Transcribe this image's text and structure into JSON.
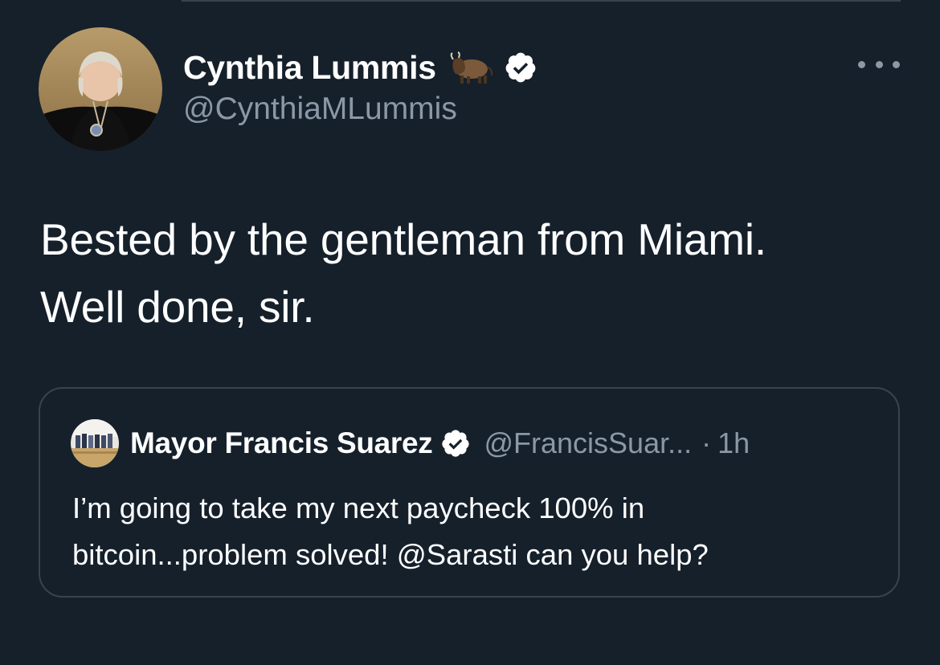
{
  "tweet": {
    "author": {
      "name": "Cynthia Lummis",
      "handle": "@CynthiaMLummis",
      "name_emoji": "bison-icon",
      "verified": true
    },
    "text_line1": "Bested by the gentleman from Miami.",
    "text_line2": "Well done, sir."
  },
  "quoted_tweet": {
    "author": {
      "name": "Mayor Francis Suarez",
      "handle": "@FrancisSuar...",
      "verified": true
    },
    "separator": "·",
    "time": "1h",
    "text_line1": "I’m going to take my next paycheck 100% in",
    "text_line2": "bitcoin...problem solved! @Sarasti can you help?"
  },
  "icons": {
    "more": "more-horizontal-icon",
    "verified": "verified-badge-icon"
  },
  "colors": {
    "background": "#15202b",
    "border": "#38444d",
    "secondary_text": "#8b98a5",
    "primary_text": "#ffffff"
  }
}
